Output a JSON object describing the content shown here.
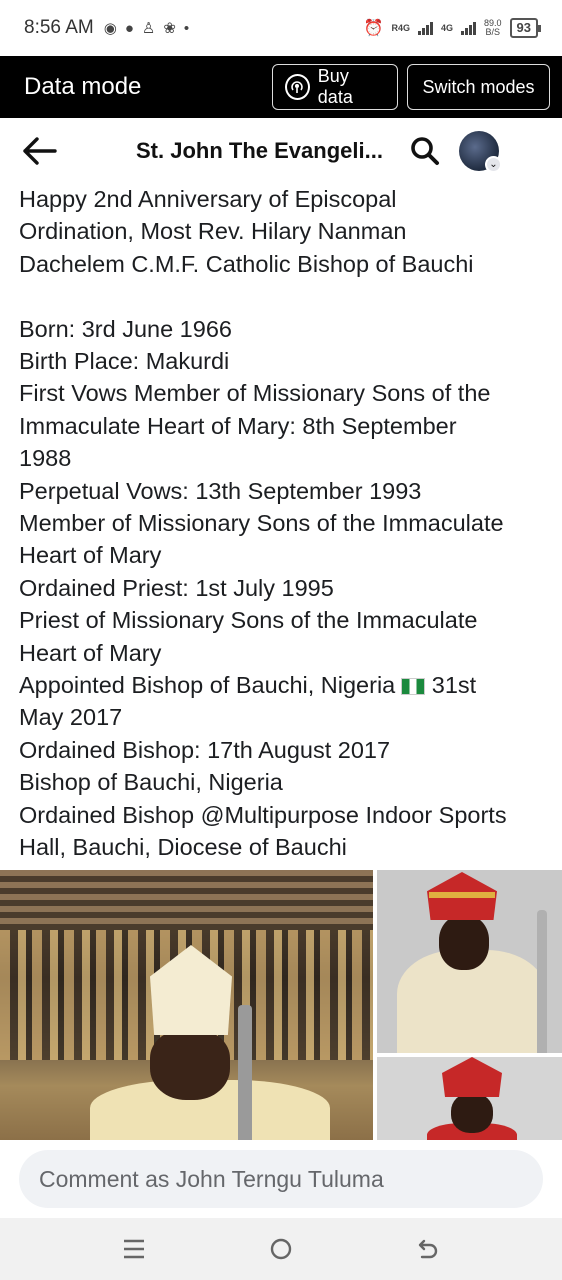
{
  "status_bar": {
    "time": "8:56 AM",
    "network_1": "R4G",
    "network_2": "4G",
    "speed_value": "89.0",
    "speed_unit": "B/S",
    "battery": "93"
  },
  "data_mode_bar": {
    "title": "Data mode",
    "buy_data_label": "Buy data",
    "switch_modes_label": "Switch modes"
  },
  "header": {
    "title": "St. John The Evangeli..."
  },
  "post": {
    "lines_intro": [
      "Happy 2nd Anniversary of Episcopal",
      "Ordination,  Most Rev. Hilary Nanman",
      "Dachelem C.M.F. Catholic Bishop of Bauchi"
    ],
    "lines_body_1": [
      "Born:  3rd June 1966",
      "Birth Place:  Makurdi",
      "First Vows Member of Missionary Sons of the",
      "Immaculate Heart of Mary:  8th September",
      "1988",
      "Perpetual Vows:   13th September 1993",
      "Member of Missionary Sons of the Immaculate",
      "Heart of Mary",
      "Ordained Priest: 1st July 1995",
      "Priest of Missionary Sons of the Immaculate",
      "Heart of Mary"
    ],
    "appointed_line_a": "Appointed Bishop of Bauchi, Nigeria",
    "appointed_line_b": " 31st",
    "lines_body_2": [
      "May 2017",
      "Ordained Bishop:  17th August 2017",
      "Bishop of Bauchi, Nigeria",
      "Ordained Bishop @Multipurpose Indoor Sports",
      "Hall, Bauchi, Diocese of Bauchi"
    ]
  },
  "comment": {
    "placeholder": "Comment as John Terngu Tuluma"
  }
}
